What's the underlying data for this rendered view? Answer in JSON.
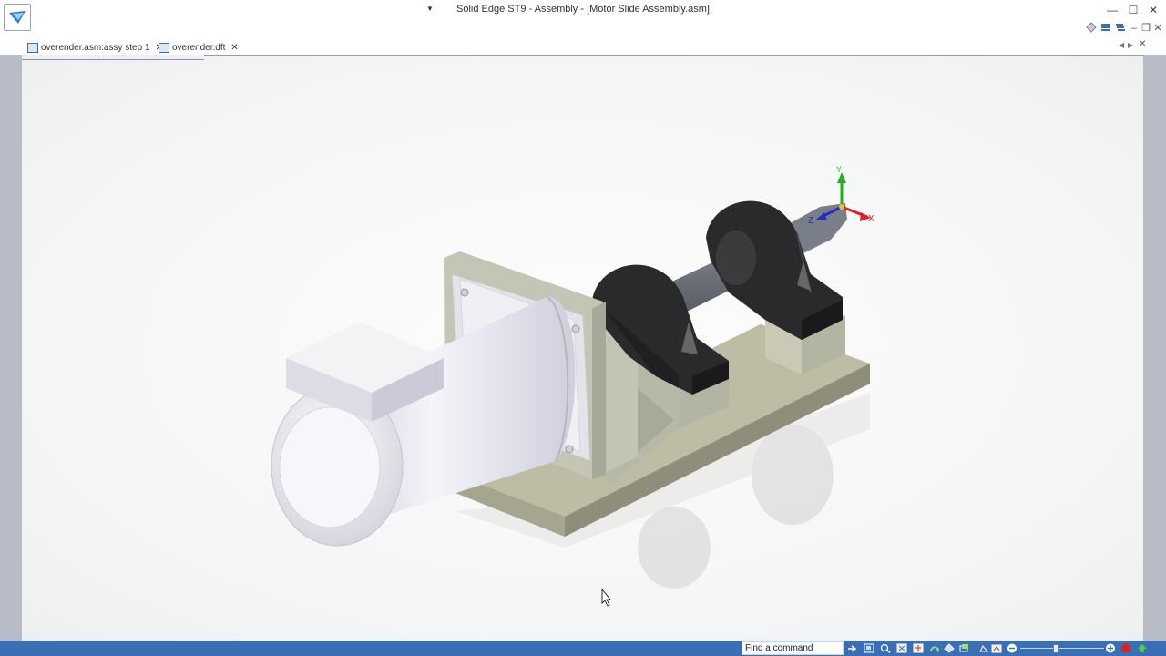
{
  "window": {
    "title": "Solid Edge ST9 - Assembly - [Motor Slide Assembly.asm]",
    "controls": {
      "minimize": "—",
      "maximize": "☐",
      "close": "✕"
    },
    "doc_controls": {
      "minimize": "–",
      "restore": "❐",
      "close": "✕"
    }
  },
  "tabs": [
    {
      "label": "overender.asm:assy step 1",
      "close": "✕",
      "icon": "assembly-doc-icon"
    },
    {
      "label": "overender.dft",
      "close": "✕",
      "icon": "draft-doc-icon"
    }
  ],
  "triad": {
    "x": "X",
    "y": "Y",
    "z": "Z"
  },
  "statusbar": {
    "find_command_value": "Find a command",
    "icons": [
      "arrow-right-icon",
      "zoom-area-icon",
      "zoom-icon",
      "fit-icon",
      "pan-icon",
      "rotate-icon",
      "spin-icon",
      "view-orient-icon",
      "sketch-view-icon",
      "sculpt-icon",
      "hide-icon"
    ]
  },
  "colors": {
    "accent": "#3a6fb5",
    "triad_x": "#e02020",
    "triad_y": "#20b020",
    "triad_z": "#2030c0"
  }
}
